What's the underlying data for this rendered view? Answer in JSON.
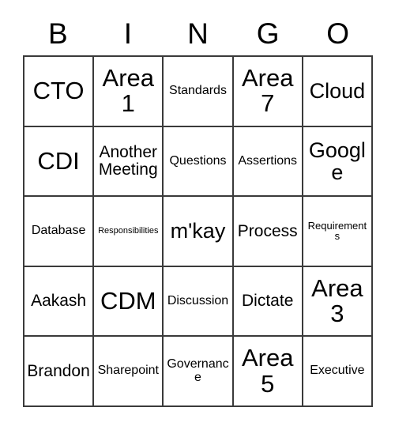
{
  "card": {
    "title": "Bingo Card",
    "headers": [
      "B",
      "I",
      "N",
      "G",
      "O"
    ],
    "rows": [
      [
        {
          "text": "CTO",
          "size": "xl"
        },
        {
          "text": "Area 1",
          "size": "xl"
        },
        {
          "text": "Standards",
          "size": "sm"
        },
        {
          "text": "Area 7",
          "size": "xl"
        },
        {
          "text": "Cloud",
          "size": "lg"
        }
      ],
      [
        {
          "text": "CDI",
          "size": "xl"
        },
        {
          "text": "Another Meeting",
          "size": "md"
        },
        {
          "text": "Questions",
          "size": "sm"
        },
        {
          "text": "Assertions",
          "size": "sm"
        },
        {
          "text": "Google",
          "size": "lg"
        }
      ],
      [
        {
          "text": "Database",
          "size": "sm"
        },
        {
          "text": "Responsibilities",
          "size": "xxs"
        },
        {
          "text": "m'kay",
          "size": "lg"
        },
        {
          "text": "Process",
          "size": "md"
        },
        {
          "text": "Requirements",
          "size": "xs"
        }
      ],
      [
        {
          "text": "Aakash",
          "size": "md"
        },
        {
          "text": "CDM",
          "size": "xl"
        },
        {
          "text": "Discussion",
          "size": "sm"
        },
        {
          "text": "Dictate",
          "size": "md"
        },
        {
          "text": "Area 3",
          "size": "xl"
        }
      ],
      [
        {
          "text": "Brandon",
          "size": "md"
        },
        {
          "text": "Sharepoint",
          "size": "sm"
        },
        {
          "text": "Governance",
          "size": "sm"
        },
        {
          "text": "Area 5",
          "size": "xl"
        },
        {
          "text": "Executive",
          "size": "sm"
        }
      ]
    ],
    "colors": {
      "border": "#3a3a3a",
      "text": "#000000",
      "background": "#ffffff"
    }
  }
}
